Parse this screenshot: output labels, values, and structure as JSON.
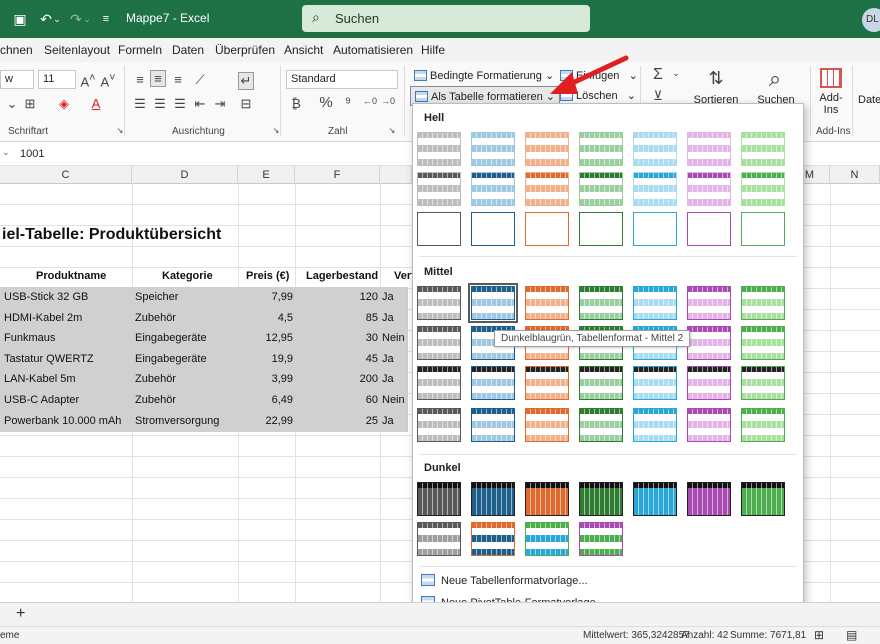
{
  "titlebar": {
    "doc_title": "Mappe7  -  Excel",
    "search_placeholder": "Suchen",
    "avatar": "DL"
  },
  "menu": {
    "items": [
      "chnen",
      "Seitenlayout",
      "Formeln",
      "Daten",
      "Überprüfen",
      "Ansicht",
      "Automatisieren",
      "Hilfe"
    ]
  },
  "ribbon": {
    "font_size": "11",
    "number_format": "Standard",
    "cond_format": "Bedingte Formatierung",
    "format_as_table": "Als Tabelle formatieren",
    "insert": "Einfügen",
    "delete": "Löschen",
    "sort_filter": "Sortieren und",
    "find_select": "Suchen und",
    "addins": "Add-\nIns",
    "data": "Date",
    "groups": {
      "font": "Schriftart",
      "alignment": "Ausrichtung",
      "number": "Zahl",
      "addins": "Add-Ins"
    }
  },
  "formula_bar": {
    "value": "1001"
  },
  "grid": {
    "columns": [
      "C",
      "D",
      "E",
      "F",
      "",
      "M",
      "N"
    ],
    "sheet_title": "iel-Tabelle: Produktübersicht",
    "headers": [
      "Produktname",
      "Kategorie",
      "Preis (€)",
      "Lagerbestand",
      "Verf"
    ],
    "rows": [
      {
        "name": "USB-Stick 32 GB",
        "category": "Speicher",
        "price": "7,99",
        "stock": "120",
        "avail": "Ja"
      },
      {
        "name": "HDMI-Kabel 2m",
        "category": "Zubehör",
        "price": "4,5",
        "stock": "85",
        "avail": "Ja"
      },
      {
        "name": "Funkmaus",
        "category": "Eingabegeräte",
        "price": "12,95",
        "stock": "30",
        "avail": "Nein"
      },
      {
        "name": "Tastatur QWERTZ",
        "category": "Eingabegeräte",
        "price": "19,9",
        "stock": "45",
        "avail": "Ja"
      },
      {
        "name": "LAN-Kabel 5m",
        "category": "Zubehör",
        "price": "3,99",
        "stock": "200",
        "avail": "Ja"
      },
      {
        "name": "USB-C Adapter",
        "category": "Zubehör",
        "price": "6,49",
        "stock": "60",
        "avail": "Nein"
      },
      {
        "name": "Powerbank 10.000 mAh",
        "category": "Stromversorgung",
        "price": "22,99",
        "stock": "25",
        "avail": "Ja"
      }
    ]
  },
  "gallery": {
    "sections": [
      "Hell",
      "Mittel",
      "Dunkel"
    ],
    "tooltip": "Dunkelblaugrün, Tabellenformat - Mittel 2",
    "new_table_style": "Neue Tabellenformatvorlage...",
    "new_pivot_style": "Neue PivotTable-Formatvorlage...",
    "palette": [
      "#595959",
      "#1f5f8b",
      "#e06a2d",
      "#2f7d32",
      "#29a7d9",
      "#a94bb3",
      "#4cae4c"
    ],
    "light_palette": [
      "#bdbdbd",
      "#9fc9e3",
      "#f2b08b",
      "#9ccf9f",
      "#a8dcf2",
      "#e3b4e8",
      "#a8e0a0"
    ]
  },
  "status": {
    "left": "eme",
    "average": "Mittelwert: 365,3242857",
    "count": "Anzahl: 42",
    "sum": "Summe: 7671,81"
  }
}
